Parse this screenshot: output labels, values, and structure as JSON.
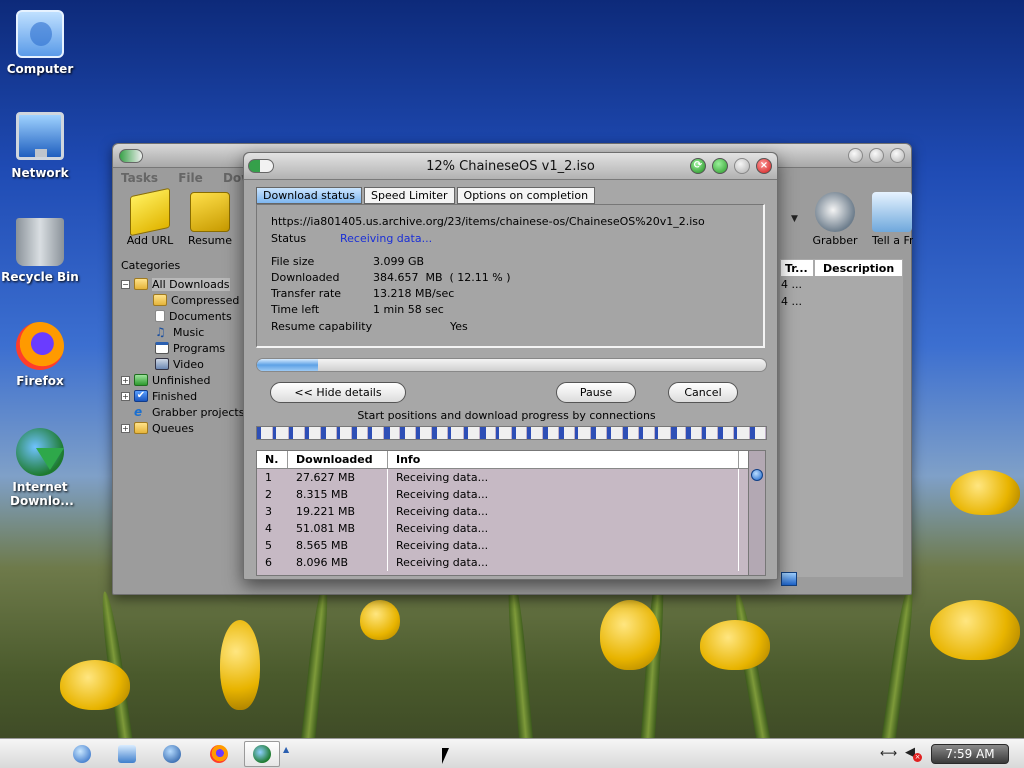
{
  "desktop": {
    "icons": [
      {
        "label": "Computer",
        "icon": "computer-icon"
      },
      {
        "label": "Network",
        "icon": "network-icon"
      },
      {
        "label": "Recycle Bin",
        "icon": "recycle-bin-icon"
      },
      {
        "label": "Firefox",
        "icon": "firefox-icon"
      },
      {
        "label": "Internet Downlo...",
        "icon": "idm-icon"
      }
    ]
  },
  "main_window": {
    "menu": [
      "Tasks",
      "File",
      "Downlo"
    ],
    "toolbar": {
      "add_url": "Add URL",
      "resume": "Resume",
      "grabber": "Grabber",
      "tell_friend": "Tell a Fri"
    },
    "categories_title": "Categories",
    "tree": {
      "all_downloads": "All Downloads",
      "compressed": "Compressed",
      "documents": "Documents",
      "music": "Music",
      "programs": "Programs",
      "video": "Video",
      "unfinished": "Unfinished",
      "finished": "Finished",
      "grabber_projects": "Grabber projects",
      "queues": "Queues"
    },
    "list_headers": {
      "tr": "Tr...",
      "description": "Description"
    },
    "list_rows": [
      "4 ...",
      "4 ..."
    ]
  },
  "dialog": {
    "title": "12% ChaineseOS v1_2.iso",
    "tabs": {
      "download_status": "Download status",
      "speed_limiter": "Speed Limiter",
      "options_on_completion": "Options on completion"
    },
    "url": "https://ia801405.us.archive.org/23/items/chainese-os/ChaineseOS%20v1_2.iso",
    "labels": {
      "status": "Status",
      "file_size": "File size",
      "downloaded": "Downloaded",
      "transfer_rate": "Transfer rate",
      "time_left": "Time left",
      "resume_capability": "Resume capability"
    },
    "values": {
      "status": "Receiving data...",
      "file_size": "3.099  GB",
      "downloaded": "384.657  MB  ( 12.11 % )",
      "transfer_rate": "13.218  MB/sec",
      "time_left": "1 min 58 sec",
      "resume_capability": "Yes"
    },
    "progress_fraction": 0.12,
    "buttons": {
      "hide_details": "<< Hide details",
      "pause": "Pause",
      "cancel": "Cancel"
    },
    "connections_caption": "Start positions and download progress by connections",
    "connection_segments": [
      0.3,
      0.2,
      0.25,
      0.3,
      0.35,
      0.2,
      0.3,
      0.25,
      0.4,
      0.3,
      0.25,
      0.35,
      0.2,
      0.3,
      0.4,
      0.2,
      0.3,
      0.25,
      0.3,
      0.35,
      0.2,
      0.3,
      0.25,
      0.35,
      0.3,
      0.2,
      0.4,
      0.3,
      0.25,
      0.35,
      0.2,
      0.3
    ],
    "connections_table": {
      "headers": {
        "n": "N.",
        "downloaded": "Downloaded",
        "info": "Info"
      },
      "rows": [
        {
          "n": "1",
          "downloaded": "27.627  MB",
          "info": "Receiving data..."
        },
        {
          "n": "2",
          "downloaded": "8.315  MB",
          "info": "Receiving data..."
        },
        {
          "n": "3",
          "downloaded": "19.221  MB",
          "info": "Receiving data..."
        },
        {
          "n": "4",
          "downloaded": "51.081  MB",
          "info": "Receiving data..."
        },
        {
          "n": "5",
          "downloaded": "8.565  MB",
          "info": "Receiving data..."
        },
        {
          "n": "6",
          "downloaded": "8.096  MB",
          "info": "Receiving data..."
        }
      ]
    }
  },
  "taskbar": {
    "clock": "7:59 AM",
    "items": [
      "apple-menu-icon",
      "browser-globe-icon",
      "file-manager-icon",
      "search-icon",
      "firefox-icon",
      "idm-icon"
    ]
  }
}
